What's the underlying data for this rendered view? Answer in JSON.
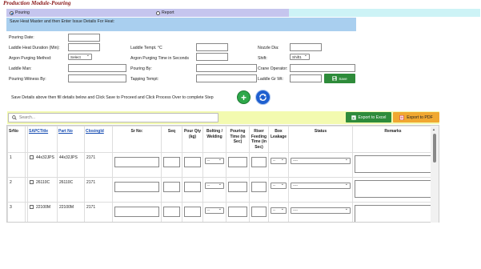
{
  "page_title": "Production Module-Pouring",
  "mode": {
    "options": [
      {
        "label": "Pouring",
        "selected": true
      },
      {
        "label": "Report",
        "selected": false
      }
    ]
  },
  "info_text": "Save Heat Master and then Enter Issue Details For Heat:",
  "form": {
    "pouring_date": "Pouring Date:",
    "laddle_heat_duration": "Laddle Heat Duration (Min):",
    "laddle_tempt": "Laddle Tempt. °C",
    "nozzle_dia": "Nozzle Dia:",
    "argon_purging_method": "Argon Purging Method:",
    "argon_purging_method_value": "Select",
    "argon_purging_time": "Argon Purging Time in Seconds",
    "shift": "Shift:",
    "shift_value": "Shift1",
    "laddle_man": "Laddle Man:",
    "pouring_by": "Pouring By:",
    "crane_operator": "Crane Operator:",
    "pouring_witness_by": "Pouring Witness By:",
    "tapping_tempt": "Tapping Tempt:",
    "laddle_gr_wt": "Laddle Gr Wt:",
    "save_label": "Save"
  },
  "instruction": "Save Details above then fill details below and Click Save to Proceed and Click Process Over to complete Step",
  "toolbar": {
    "search_placeholder": "Search...",
    "export_excel": "Export to Excel",
    "export_pdf": "Export to PDF"
  },
  "table": {
    "headers": {
      "srno": "SrNo",
      "sapctitle": "SAPCTitle",
      "partno": "Part No",
      "closingid": "ClosingId",
      "sr_no": "Sr No:",
      "seq": "Seq",
      "pour_qty": "Pour Qty (kg)",
      "bolting": "Bolting / Welding",
      "pouring_time": "Pouring Time (in Sec)",
      "riser_time": "Riser Feeding Time (in Sec)",
      "box_leakage": "Box Leakage",
      "status": "Status",
      "remarks": "Remarks"
    },
    "select_placeholder": "--",
    "status_placeholder": "----",
    "rows": [
      {
        "srno": "1",
        "sapctitle": "44x32JPS",
        "partno": "44x32JPS",
        "closingid": "2171"
      },
      {
        "srno": "2",
        "sapctitle": "26110C",
        "partno": "26110C",
        "closingid": "2171"
      },
      {
        "srno": "3",
        "sapctitle": "22100M",
        "partno": "22100M",
        "closingid": "2171"
      }
    ]
  },
  "colors": {
    "title": "#8b1a1a",
    "mode_left": "#c5c5ee",
    "mode_right": "#cdf3f6",
    "info_bar": "#a9cfef",
    "toolbar": "#f3fab0",
    "excel": "#2e8b3a",
    "pdf": "#f0a830",
    "link": "#1a4fb3"
  }
}
